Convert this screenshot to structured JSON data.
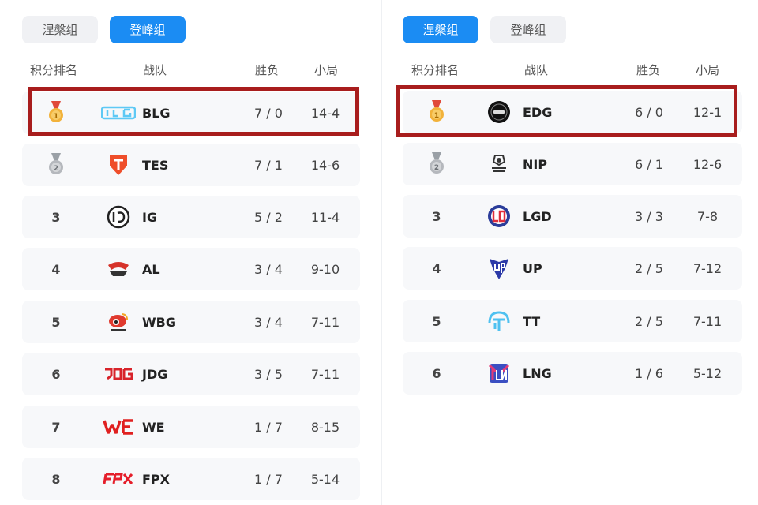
{
  "left": {
    "tabs": [
      {
        "label": "涅槃组",
        "active": false
      },
      {
        "label": "登峰组",
        "active": true
      }
    ],
    "headers": {
      "rank": "积分排名",
      "team": "战队",
      "wl": "胜负",
      "games": "小局"
    },
    "rows": [
      {
        "rank": "",
        "medal": "gold",
        "logo": "blg-logo",
        "team": "BLG",
        "wl": "7 / 0",
        "games": "14-4",
        "highlighted": true
      },
      {
        "rank": "",
        "medal": "silver",
        "logo": "tes-logo",
        "team": "TES",
        "wl": "7 / 1",
        "games": "14-6"
      },
      {
        "rank": "3",
        "logo": "ig-logo",
        "team": "IG",
        "wl": "5 / 2",
        "games": "11-4"
      },
      {
        "rank": "4",
        "logo": "al-logo",
        "team": "AL",
        "wl": "3 / 4",
        "games": "9-10"
      },
      {
        "rank": "5",
        "logo": "wbg-logo",
        "team": "WBG",
        "wl": "3 / 4",
        "games": "7-11"
      },
      {
        "rank": "6",
        "logo": "jdg-logo",
        "team": "JDG",
        "wl": "3 / 5",
        "games": "7-11"
      },
      {
        "rank": "7",
        "logo": "we-logo",
        "team": "WE",
        "wl": "1 / 7",
        "games": "8-15"
      },
      {
        "rank": "8",
        "logo": "fpx-logo",
        "team": "FPX",
        "wl": "1 / 7",
        "games": "5-14"
      }
    ]
  },
  "right": {
    "tabs": [
      {
        "label": "涅槃组",
        "active": true
      },
      {
        "label": "登峰组",
        "active": false
      }
    ],
    "headers": {
      "rank": "积分排名",
      "team": "战队",
      "wl": "胜负",
      "games": "小局"
    },
    "rows": [
      {
        "rank": "",
        "medal": "gold",
        "logo": "edg-logo",
        "team": "EDG",
        "wl": "6 / 0",
        "games": "12-1",
        "highlighted": true
      },
      {
        "rank": "",
        "medal": "silver",
        "logo": "nip-logo",
        "team": "NIP",
        "wl": "6 / 1",
        "games": "12-6"
      },
      {
        "rank": "3",
        "logo": "lgd-logo",
        "team": "LGD",
        "wl": "3 / 3",
        "games": "7-8"
      },
      {
        "rank": "4",
        "logo": "up-logo",
        "team": "UP",
        "wl": "2 / 5",
        "games": "7-12"
      },
      {
        "rank": "5",
        "logo": "tt-logo",
        "team": "TT",
        "wl": "2 / 5",
        "games": "7-11"
      },
      {
        "rank": "6",
        "logo": "lng-logo",
        "team": "LNG",
        "wl": "1 / 6",
        "games": "5-12"
      }
    ]
  },
  "colors": {
    "active_tab": "#1b8cf3",
    "inactive_tab": "#f0f1f4",
    "row_bg": "#f7f8fa",
    "highlight_border": "#a81d1d",
    "gold_medal": "#f2b23a",
    "silver_medal": "#b5b8bd"
  }
}
